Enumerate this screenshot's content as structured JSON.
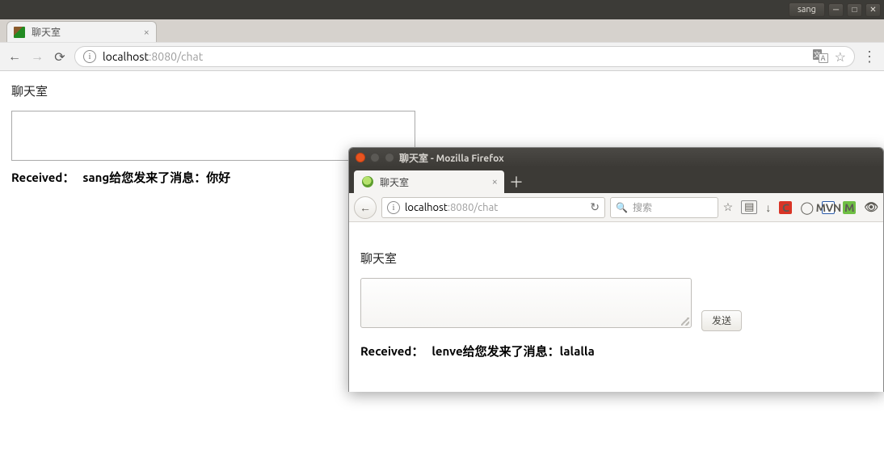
{
  "desktop": {
    "user": "sang"
  },
  "chrome": {
    "tab_title": "聊天室",
    "url_host": "localhost",
    "url_port_path": ":8080/chat",
    "page": {
      "title": "聊天室",
      "received_label": "Received：",
      "received_text": "sang给您发来了消息：你好"
    }
  },
  "firefox": {
    "window_title": "聊天室 - Mozilla Firefox",
    "tab_title": "聊天室",
    "url_host": "localhost",
    "url_port_path": ":8080/chat",
    "search_placeholder": "搜索",
    "page": {
      "title": "聊天室",
      "send_label": "发送",
      "received_label": "Received：",
      "received_text": "lenve给您发来了消息：lalalla"
    },
    "toolbar_icons": {
      "c": "C",
      "mvn": "MVN",
      "m": "M"
    }
  }
}
